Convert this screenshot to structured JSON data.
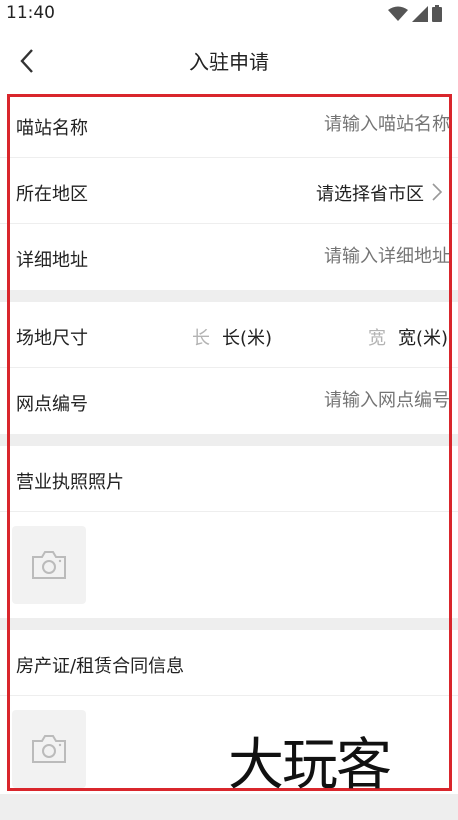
{
  "status_bar": {
    "time": "11:40"
  },
  "header": {
    "title": "入驻申请"
  },
  "form": {
    "station_name": {
      "label": "喵站名称",
      "placeholder": "请输入喵站名称"
    },
    "region": {
      "label": "所在地区",
      "value": "请选择省市区"
    },
    "address": {
      "label": "详细地址",
      "placeholder": "请输入详细地址"
    },
    "site_size": {
      "label": "场地尺寸",
      "length_label": "长",
      "length_value": "长(米)",
      "width_label": "宽",
      "width_value": "宽(米)"
    },
    "outlet_number": {
      "label": "网点编号",
      "placeholder": "请输入网点编号"
    },
    "business_license": {
      "label": "营业执照照片"
    },
    "property_info": {
      "label": "房产证/租赁合同信息"
    }
  },
  "watermark": "大玩客",
  "colors": {
    "highlight_border": "#d9262c",
    "divider": "#eeeeee",
    "placeholder": "#b3b3b3"
  }
}
